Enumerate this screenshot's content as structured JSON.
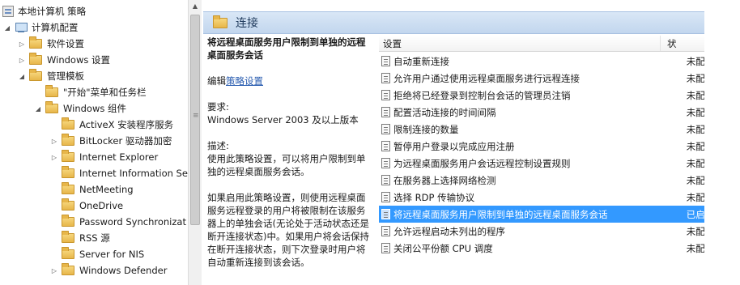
{
  "tree": {
    "items": [
      {
        "label": "本地计算机 策略",
        "icon": "policy-icon",
        "expand": ""
      },
      {
        "label": "计算机配置",
        "icon": "computer-icon",
        "expand": "◢"
      },
      {
        "label": "软件设置",
        "icon": "folder-icon",
        "expand": "▷"
      },
      {
        "label": "Windows 设置",
        "icon": "folder-icon",
        "expand": "▷"
      },
      {
        "label": "管理模板",
        "icon": "folder-icon",
        "expand": "◢"
      },
      {
        "label": "\"开始\"菜单和任务栏",
        "icon": "folder-icon",
        "expand": ""
      },
      {
        "label": "Windows 组件",
        "icon": "folder-icon",
        "expand": "◢"
      },
      {
        "label": "ActiveX 安装程序服务",
        "icon": "folder-icon",
        "expand": ""
      },
      {
        "label": "BitLocker 驱动器加密",
        "icon": "folder-icon",
        "expand": "▷"
      },
      {
        "label": "Internet Explorer",
        "icon": "folder-icon",
        "expand": "▷"
      },
      {
        "label": "Internet Information Se",
        "icon": "folder-icon",
        "expand": ""
      },
      {
        "label": "NetMeeting",
        "icon": "folder-icon",
        "expand": ""
      },
      {
        "label": "OneDrive",
        "icon": "folder-icon",
        "expand": ""
      },
      {
        "label": "Password Synchronizat",
        "icon": "folder-icon",
        "expand": ""
      },
      {
        "label": "RSS 源",
        "icon": "folder-icon",
        "expand": ""
      },
      {
        "label": "Server for NIS",
        "icon": "folder-icon",
        "expand": ""
      },
      {
        "label": "Windows Defender",
        "icon": "folder-icon",
        "expand": "▷"
      }
    ]
  },
  "banner": {
    "title": "连接"
  },
  "description": {
    "title": "将远程桌面服务用户限制到单独的远程桌面服务会话",
    "edit_prefix": "编辑",
    "edit_link": "策略设置",
    "req_label": "要求:",
    "req_value": "Windows Server 2003 及以上版本",
    "desc_label": "描述:",
    "desc_text": "使用此策略设置，可以将用户限制到单独的远程桌面服务会话。",
    "desc_more": "如果启用此策略设置，则使用远程桌面服务远程登录的用户将被限制在该服务器上的单独会话(无论处于活动状态还是断开连接状态)中。如果用户将会话保持在断开连接状态，则下次登录时用户将自动重新连接到该会话。"
  },
  "list": {
    "header_setting": "设置",
    "header_state": "状",
    "rows": [
      {
        "name": "自动重新连接",
        "state": "未配",
        "selected": false
      },
      {
        "name": "允许用户通过使用远程桌面服务进行远程连接",
        "state": "未配",
        "selected": false
      },
      {
        "name": "拒绝将已经登录到控制台会话的管理员注销",
        "state": "未配",
        "selected": false
      },
      {
        "name": "配置活动连接的时间间隔",
        "state": "未配",
        "selected": false
      },
      {
        "name": "限制连接的数量",
        "state": "未配",
        "selected": false
      },
      {
        "name": "暂停用户登录以完成应用注册",
        "state": "未配",
        "selected": false
      },
      {
        "name": "为远程桌面服务用户会话远程控制设置规则",
        "state": "未配",
        "selected": false
      },
      {
        "name": "在服务器上选择网络检测",
        "state": "未配",
        "selected": false
      },
      {
        "name": "选择 RDP 传输协议",
        "state": "未配",
        "selected": false
      },
      {
        "name": "将远程桌面服务用户限制到单独的远程桌面服务会话",
        "state": "已启",
        "selected": true
      },
      {
        "name": "允许远程启动未列出的程序",
        "state": "未配",
        "selected": false
      },
      {
        "name": "关闭公平份额 CPU 调度",
        "state": "未配",
        "selected": false
      }
    ]
  },
  "colors": {
    "selection": "#3399ff",
    "banner": "#c9dbf0",
    "link": "#2a5db0"
  }
}
